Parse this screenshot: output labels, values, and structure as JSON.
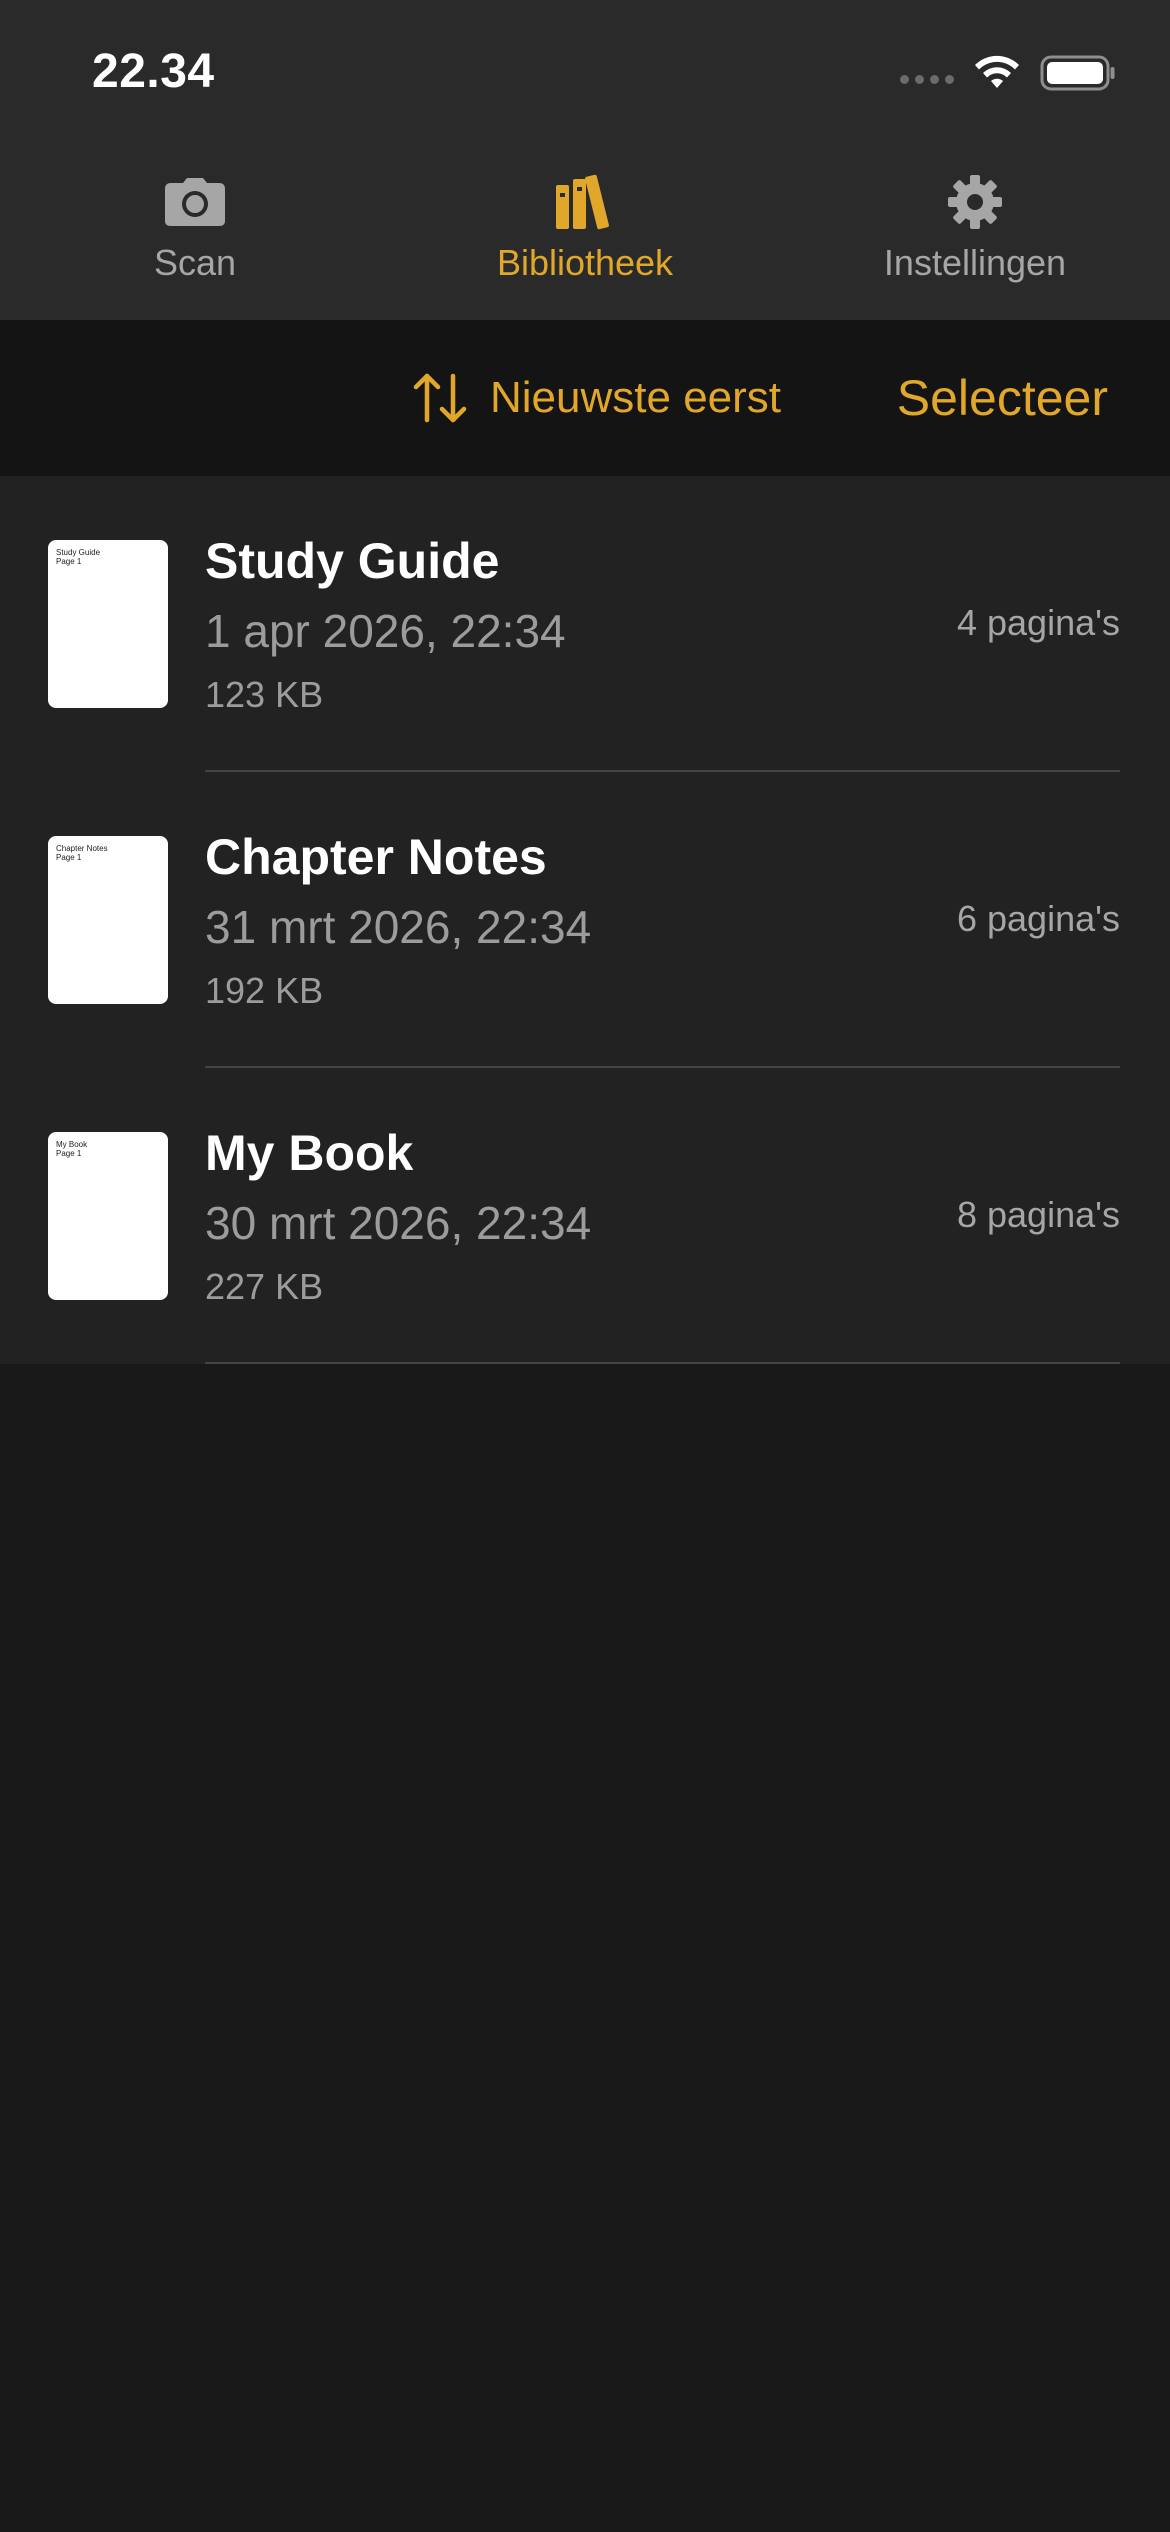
{
  "status_bar": {
    "time": "22.34"
  },
  "tabs": [
    {
      "label": "Scan",
      "icon": "camera-icon",
      "active": false
    },
    {
      "label": "Bibliotheek",
      "icon": "books-icon",
      "active": true
    },
    {
      "label": "Instellingen",
      "icon": "gear-icon",
      "active": false
    }
  ],
  "toolbar": {
    "sort_label": "Nieuwste eerst",
    "sort_icon": "sort-arrows-icon",
    "select_label": "Selecteer"
  },
  "documents": [
    {
      "title": "Study Guide",
      "date": "1 apr 2026, 22:34",
      "size": "123 KB",
      "pages": "4 pagina's",
      "thumb_line1": "Study Guide",
      "thumb_line2": "Page 1"
    },
    {
      "title": "Chapter Notes",
      "date": "31 mrt 2026, 22:34",
      "size": "192 KB",
      "pages": "6 pagina's",
      "thumb_line1": "Chapter Notes",
      "thumb_line2": "Page 1"
    },
    {
      "title": "My Book",
      "date": "30 mrt 2026, 22:34",
      "size": "227 KB",
      "pages": "8 pagina's",
      "thumb_line1": "My Book",
      "thumb_line2": "Page 1"
    }
  ],
  "colors": {
    "accent": "#e0a72a",
    "background": "#191919",
    "bar_background": "#2a2a2a",
    "list_background": "#222222",
    "secondary_text": "#9c9c9c"
  }
}
